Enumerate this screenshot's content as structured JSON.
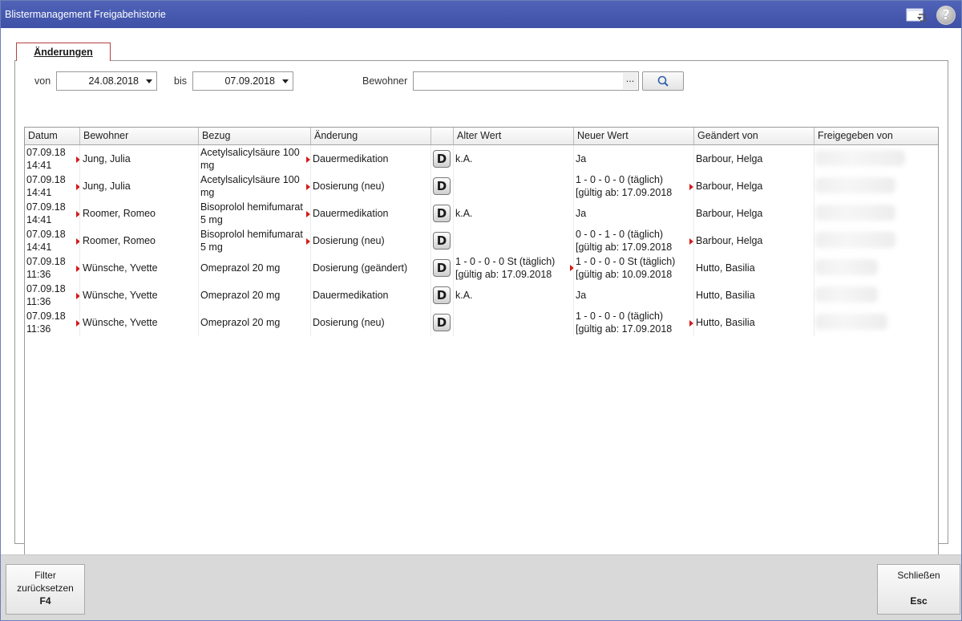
{
  "window": {
    "title": "Blistermanagement Freigabehistorie"
  },
  "tabs": [
    {
      "label": "Änderungen",
      "active": true
    }
  ],
  "filter": {
    "from_label": "von",
    "from_value": "24.08.2018",
    "to_label": "bis",
    "to_value": "07.09.2018",
    "resident_label": "Bewohner",
    "resident_value": "",
    "browse_label": "..."
  },
  "table": {
    "columns": [
      "Datum",
      "Bewohner",
      "Bezug",
      "Änderung",
      "",
      "Alter Wert",
      "Neuer Wert",
      "Geändert von",
      "Freigegeben von"
    ],
    "rows": [
      {
        "date": "07.09.18",
        "time": "14:41",
        "resident": "Jung, Julia",
        "ref1": "Acetylsalicylsäure 100",
        "ref2": "mg",
        "change": "Dauermedikation",
        "change_marker": true,
        "dbtn": "D",
        "old1": "k.A.",
        "old2": "",
        "new1": "Ja",
        "new2": "",
        "new_marker": false,
        "changed_by": "Barbour, Helga",
        "changed_marker": false
      },
      {
        "date": "07.09.18",
        "time": "14:41",
        "resident": "Jung, Julia",
        "ref1": "Acetylsalicylsäure 100",
        "ref2": "mg",
        "change": "Dosierung (neu)",
        "change_marker": true,
        "dbtn": "D",
        "old1": "",
        "old2": "",
        "new1": "1 - 0 - 0 - 0 (täglich)",
        "new2": "[gültig ab: 17.09.2018",
        "new_marker": false,
        "changed_by": "Barbour, Helga",
        "changed_marker": true
      },
      {
        "date": "07.09.18",
        "time": "14:41",
        "resident": "Roomer, Romeo",
        "ref1": "Bisoprolol hemifumarat",
        "ref2": "5 mg",
        "change": "Dauermedikation",
        "change_marker": true,
        "dbtn": "D",
        "old1": "k.A.",
        "old2": "",
        "new1": "Ja",
        "new2": "",
        "new_marker": false,
        "changed_by": "Barbour, Helga",
        "changed_marker": false
      },
      {
        "date": "07.09.18",
        "time": "14:41",
        "resident": "Roomer, Romeo",
        "ref1": "Bisoprolol hemifumarat",
        "ref2": "5 mg",
        "change": "Dosierung (neu)",
        "change_marker": true,
        "dbtn": "D",
        "old1": "",
        "old2": "",
        "new1": "0 - 0 - 1 - 0 (täglich)",
        "new2": "[gültig ab: 17.09.2018",
        "new_marker": false,
        "changed_by": "Barbour, Helga",
        "changed_marker": true
      },
      {
        "date": "07.09.18",
        "time": "11:36",
        "resident": "Wünsche, Yvette",
        "ref1": "Omeprazol 20 mg",
        "ref2": "",
        "change": "Dosierung (geändert)",
        "change_marker": false,
        "dbtn": "D",
        "old1": "1 - 0 - 0 - 0 St (täglich)",
        "old2": "[gültig ab: 17.09.2018",
        "new1": "1 - 0 - 0 - 0 St (täglich)",
        "new2": "[gültig ab: 10.09.2018",
        "new_marker": true,
        "changed_by": "Hutto, Basilia",
        "changed_marker": false
      },
      {
        "date": "07.09.18",
        "time": "11:36",
        "resident": "Wünsche, Yvette",
        "ref1": "Omeprazol 20 mg",
        "ref2": "",
        "change": "Dauermedikation",
        "change_marker": false,
        "dbtn": "D",
        "old1": "k.A.",
        "old2": "",
        "new1": "Ja",
        "new2": "",
        "new_marker": false,
        "changed_by": "Hutto, Basilia",
        "changed_marker": false
      },
      {
        "date": "07.09.18",
        "time": "11:36",
        "resident": "Wünsche, Yvette",
        "ref1": "Omeprazol 20 mg",
        "ref2": "",
        "change": "Dosierung (neu)",
        "change_marker": false,
        "dbtn": "D",
        "old1": "",
        "old2": "",
        "new1": "1 - 0 - 0 - 0 (täglich)",
        "new2": "[gültig ab: 17.09.2018",
        "new_marker": false,
        "changed_by": "Hutto, Basilia",
        "changed_marker": true
      }
    ]
  },
  "footer": {
    "reset": {
      "line1": "Filter",
      "line2": "zurücksetzen",
      "key": "F4"
    },
    "close": {
      "line1": "Schließen",
      "key": "Esc"
    }
  },
  "colors": {
    "titlebar": "#4557ac",
    "marker": "#d41c1c",
    "tab_border": "#b34040"
  },
  "icons": {
    "window_icon": "window-switch-icon",
    "help_icon": "help-icon",
    "search_icon": "magnifier-icon",
    "dropdown_icon": "chevron-down-icon",
    "row_marker": "red-triangle-icon"
  }
}
